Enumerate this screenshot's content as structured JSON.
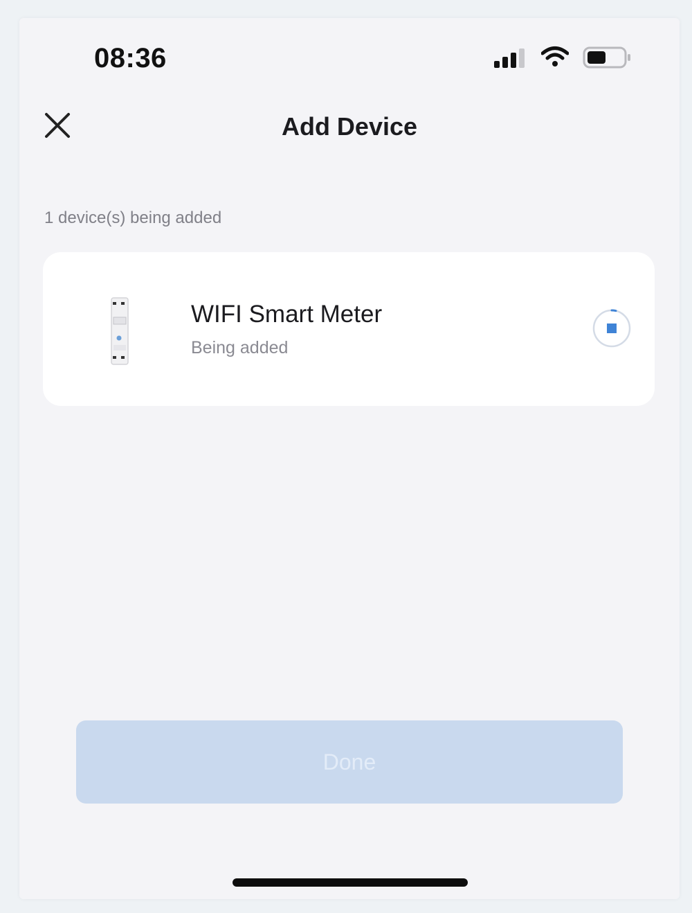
{
  "status_bar": {
    "time": "08:36",
    "icons": [
      "cellular-signal-icon",
      "wifi-icon",
      "battery-icon"
    ]
  },
  "header": {
    "close_icon": "close-icon",
    "title": "Add Device"
  },
  "summary": {
    "text": "1 device(s) being added"
  },
  "devices": [
    {
      "name": "WIFI Smart Meter",
      "status": "Being added",
      "image": "din-rail-meter-image",
      "action_icon": "stop-progress-icon"
    }
  ],
  "footer": {
    "done_label": "Done"
  },
  "colors": {
    "background": "#f4f4f7",
    "card": "#ffffff",
    "accent": "#3f83d6",
    "done_disabled": "#c9d9ee"
  }
}
